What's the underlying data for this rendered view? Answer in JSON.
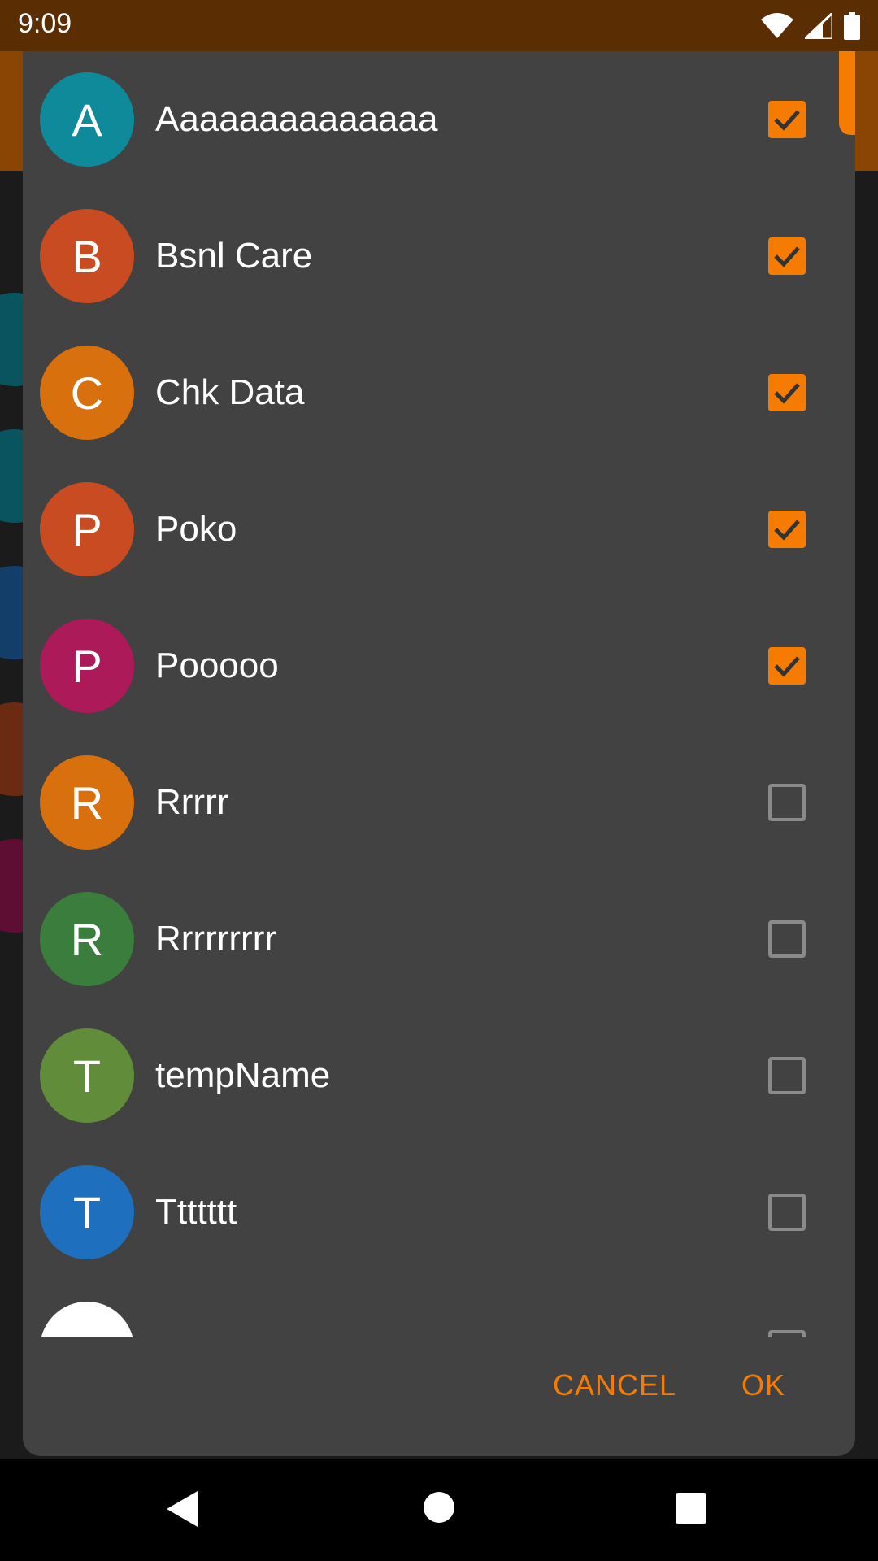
{
  "status_bar": {
    "time": "9:09",
    "icons": [
      "wifi-icon",
      "cellular-signal-icon",
      "battery-icon"
    ]
  },
  "dialog": {
    "contacts": [
      {
        "initial": "A",
        "name": "Aaaaaaaaaaaaaa",
        "color": "#0e8a9b",
        "checked": true
      },
      {
        "initial": "B",
        "name": "Bsnl Care",
        "color": "#c84b22",
        "checked": true
      },
      {
        "initial": "C",
        "name": "Chk Data",
        "color": "#d8700d",
        "checked": true
      },
      {
        "initial": "P",
        "name": "Poko",
        "color": "#c84b22",
        "checked": true
      },
      {
        "initial": "P",
        "name": "Pooooo",
        "color": "#ad1a5a",
        "checked": true
      },
      {
        "initial": "R",
        "name": "Rrrrr",
        "color": "#d8700d",
        "checked": false
      },
      {
        "initial": "R",
        "name": "Rrrrrrrrr",
        "color": "#3a7d3c",
        "checked": false
      },
      {
        "initial": "T",
        "name": "tempName",
        "color": "#618d3a",
        "checked": false
      },
      {
        "initial": "T",
        "name": "Ttttttt",
        "color": "#1f6fbf",
        "checked": false
      }
    ],
    "cancel_label": "CANCEL",
    "ok_label": "OK"
  },
  "colors": {
    "accent": "#f57c00",
    "dialog_bg": "#424242",
    "status_bar": "#5a2e02",
    "app_bar": "#8a4504"
  },
  "nav_bar": {
    "icons": [
      "back-icon",
      "home-icon",
      "recents-icon"
    ]
  }
}
